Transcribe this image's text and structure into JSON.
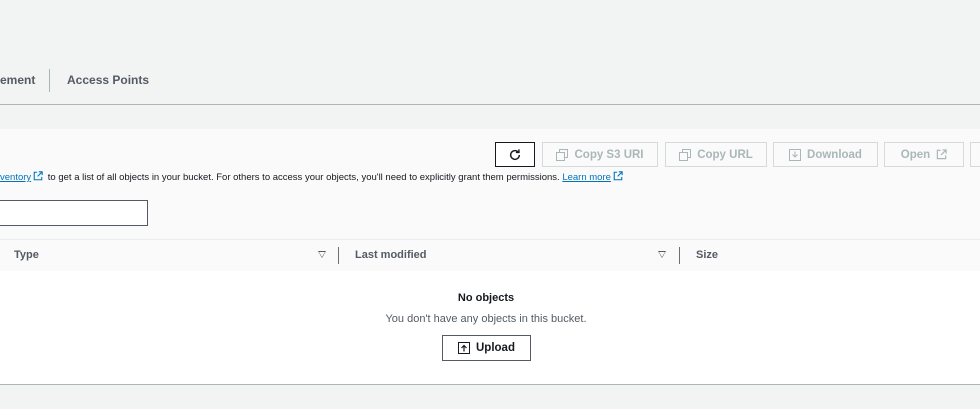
{
  "tabs": {
    "partial_label": "ement",
    "access_points_label": "Access Points"
  },
  "toolbar": {
    "copy_s3_uri_label": "Copy S3 URI",
    "copy_url_label": "Copy URL",
    "download_label": "Download",
    "open_label": "Open"
  },
  "info": {
    "inventory_link": "ventory",
    "text": " to get a list of all objects in your bucket. For others to access your objects, you'll need to explicitly grant them permissions. ",
    "learn_more": "Learn more"
  },
  "search": {
    "value": ""
  },
  "table": {
    "columns": [
      "Type",
      "Last modified",
      "Size"
    ]
  },
  "empty_state": {
    "title": "No objects",
    "subtitle": "You don't have any objects in this bucket.",
    "upload_label": "Upload"
  }
}
